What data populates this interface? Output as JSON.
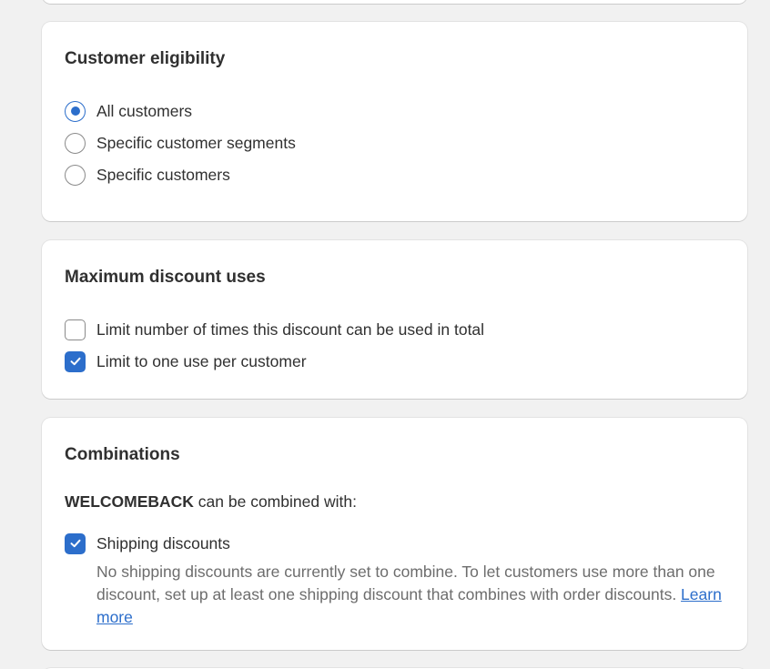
{
  "customer_eligibility": {
    "title": "Customer eligibility",
    "options": [
      {
        "label": "All customers",
        "selected": true
      },
      {
        "label": "Specific customer segments",
        "selected": false
      },
      {
        "label": "Specific customers",
        "selected": false
      }
    ]
  },
  "maximum_discount_uses": {
    "title": "Maximum discount uses",
    "options": [
      {
        "label": "Limit number of times this discount can be used in total",
        "checked": false
      },
      {
        "label": "Limit to one use per customer",
        "checked": true
      }
    ]
  },
  "combinations": {
    "title": "Combinations",
    "discount_code": "WELCOMEBACK",
    "combined_with_text": " can be combined with:",
    "options": [
      {
        "label": "Shipping discounts",
        "checked": true
      }
    ],
    "help_text": "No shipping discounts are currently set to combine. To let customers use more than one discount, set up at least one shipping discount that combines with order discounts. ",
    "learn_more_label": "Learn more"
  },
  "colors": {
    "accent": "#2c6ecb",
    "background": "#f1f1f1",
    "card": "#ffffff",
    "text": "#303030",
    "muted_text": "#6d6d6d"
  },
  "icons": {
    "check": "checkmark-icon"
  }
}
